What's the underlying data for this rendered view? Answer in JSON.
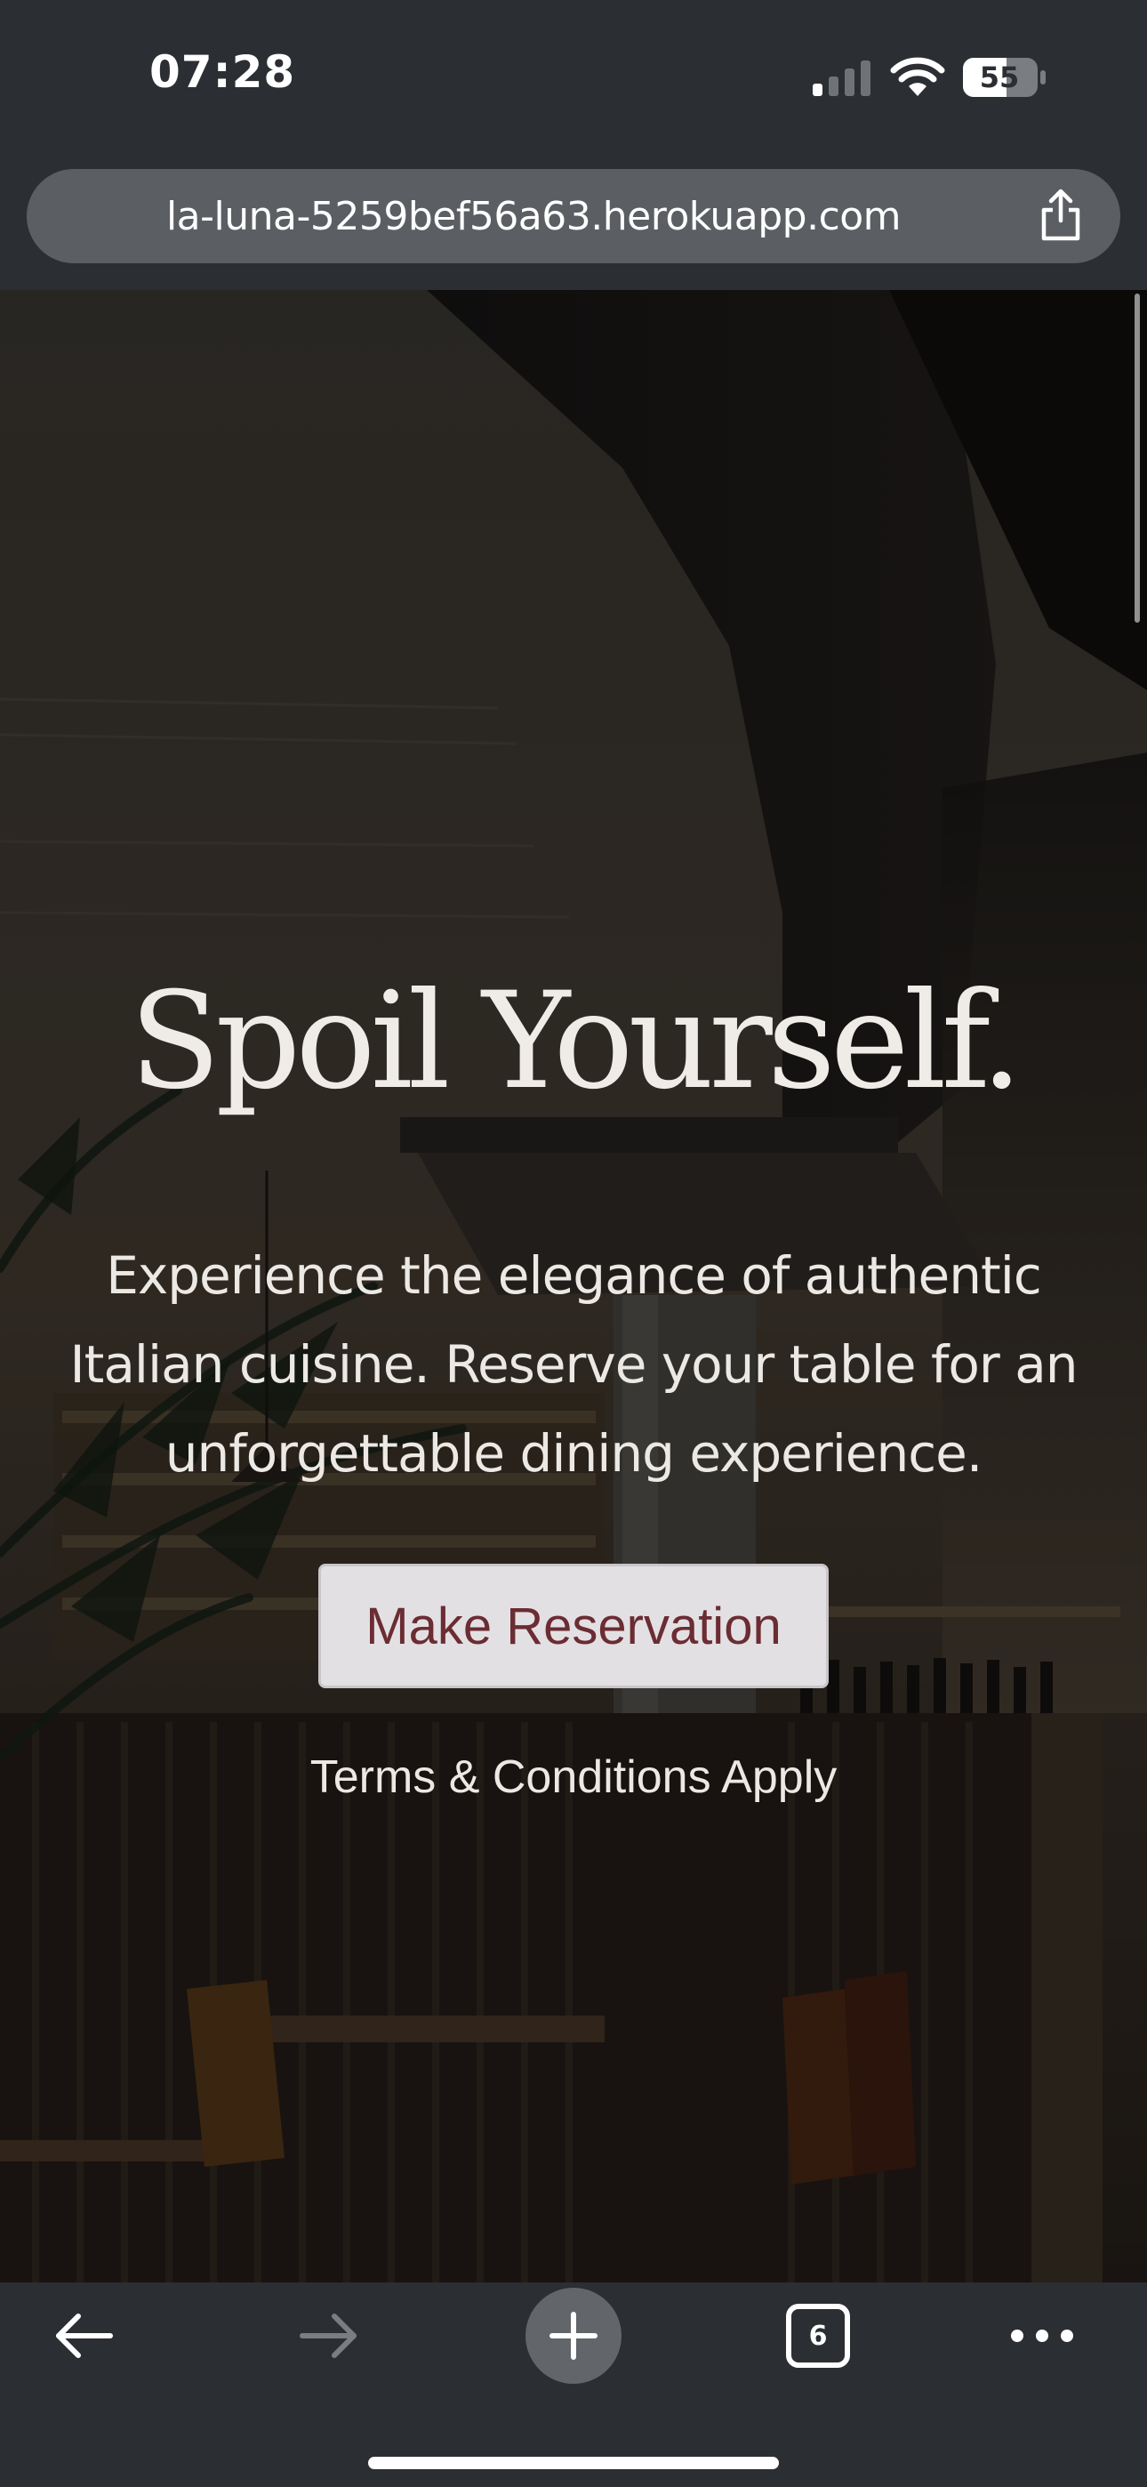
{
  "status_bar": {
    "time": "07:28",
    "battery_level": "55",
    "icons": [
      "signal-icon",
      "wifi-icon",
      "battery-icon"
    ]
  },
  "browser": {
    "url": "la-luna-5259bef56a63.herokuapp.com",
    "share_icon": "share-icon",
    "tab_count": "6",
    "toolbar_icons": [
      "back-arrow-icon",
      "forward-arrow-icon",
      "plus-icon",
      "tabs-icon",
      "more-dots-icon"
    ]
  },
  "hero": {
    "title": "Spoil Yourself.",
    "description": "Experience the elegance of authentic Italian cuisine. Reserve your table for an unforgettable dining experience.",
    "button_label": "Make Reservation",
    "terms": "Terms & Conditions Apply"
  },
  "colors": {
    "chrome_bg": "#2b2e32",
    "url_bar_bg": "#5b5f64",
    "button_bg": "#e3e0e3",
    "button_text": "#6b2c33",
    "hero_text": "#efebe6"
  }
}
